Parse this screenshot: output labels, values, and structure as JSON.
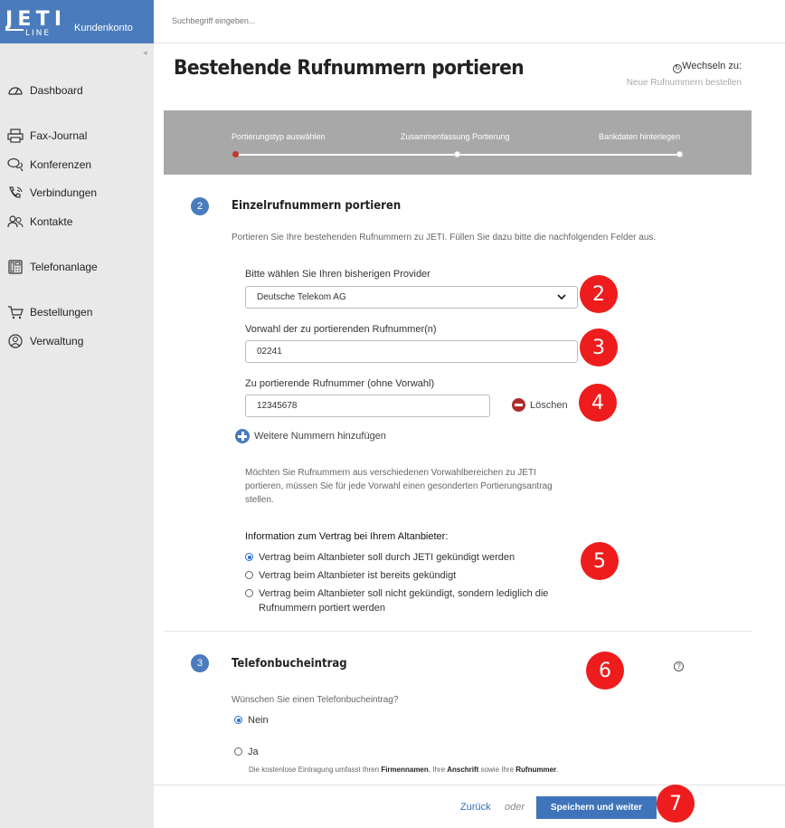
{
  "brand": {
    "logo_text": "JETI LINE",
    "subtitle": "Kundenkonto",
    "color": "#4a7bbd"
  },
  "search": {
    "placeholder": "Suchbegriff eingeben..."
  },
  "sidebar": {
    "items": [
      {
        "label": "Dashboard",
        "icon": "gauge-icon"
      },
      {
        "label": "Fax-Journal",
        "icon": "printer-icon"
      },
      {
        "label": "Konferenzen",
        "icon": "chat-icon"
      },
      {
        "label": "Verbindungen",
        "icon": "phone-icon"
      },
      {
        "label": "Kontakte",
        "icon": "contacts-icon"
      },
      {
        "label": "Telefonanlage",
        "icon": "desk-phone-icon"
      },
      {
        "label": "Bestellungen",
        "icon": "cart-icon"
      },
      {
        "label": "Verwaltung",
        "icon": "user-circle-icon"
      }
    ]
  },
  "page": {
    "title": "Bestehende Rufnummern portieren",
    "switch_label": "Wechseln zu:",
    "switch_link": "Neue Rufnummern bestellen"
  },
  "steps": {
    "items": [
      "Portierungstyp auswählen",
      "Zusammenfassung Portierung",
      "Bankdaten hinterlegen"
    ],
    "active_index": 0
  },
  "section2": {
    "number": "2",
    "title": "Einzelrufnummern portieren",
    "intro": "Portieren Sie Ihre bestehenden Rufnummern zu JETI. Füllen Sie dazu bitte die nachfolgenden Felder aus.",
    "provider_label": "Bitte wählen Sie Ihren bisherigen Provider",
    "provider_value": "Deutsche Telekom AG",
    "area_label": "Vorwahl der zu portierenden Rufnummer(n)",
    "area_value": "02241",
    "number_label": "Zu portierende Rufnummer (ohne Vorwahl)",
    "number_value": "12345678",
    "delete_label": "Löschen",
    "add_label": "Weitere Nummern hinzufügen",
    "info_lines": [
      "Möchten Sie Rufnummern aus verschiedenen Vorwahlbereichen zu JETI",
      "portieren, müssen Sie für jede Vorwahl einen gesonderten Portierungsantrag",
      "stellen."
    ],
    "contract_title": "Information zum Vertrag bei Ihrem Altanbieter:",
    "contract_options": [
      {
        "lines": [
          "Vertrag beim Altanbieter soll durch JETI gekündigt werden"
        ],
        "selected": true
      },
      {
        "lines": [
          "Vertrag beim Altanbieter ist bereits gekündigt"
        ],
        "selected": false
      },
      {
        "lines": [
          "Vertrag beim Altanbieter soll nicht gekündigt, sondern lediglich die",
          "Rufnummern portiert werden"
        ],
        "selected": false
      }
    ]
  },
  "section3": {
    "number": "3",
    "title": "Telefonbucheintrag",
    "question": "Wünschen Sie einen Telefonbucheintrag?",
    "option_no": "Nein",
    "option_yes": "Ja",
    "selected": "Nein",
    "note_parts": [
      "Die kostenlose Eintragung umfasst Ihren ",
      "Firmennamen",
      ", Ihre ",
      "Anschrift",
      " sowie Ihre ",
      "Rufnummer",
      "."
    ]
  },
  "callouts": [
    "2",
    "3",
    "4",
    "5",
    "6",
    "7"
  ],
  "footer": {
    "back_label": "Zurück",
    "or_label": "oder",
    "save_label": "Speichern und weiter"
  }
}
